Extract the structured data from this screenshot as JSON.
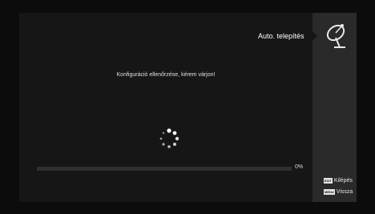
{
  "header": {
    "title": "Auto. telepítés"
  },
  "icons": {
    "dish": "satellite-dish-icon",
    "spinner": "loading-spinner-icon"
  },
  "main": {
    "message": "Konfiguráció ellenőrzése, kérem várjon!"
  },
  "progress": {
    "value": 0,
    "label": "0%"
  },
  "help": [
    {
      "key": "EXIT",
      "label": "Kilépés"
    },
    {
      "key": "MENU",
      "label": "Vissza"
    }
  ]
}
